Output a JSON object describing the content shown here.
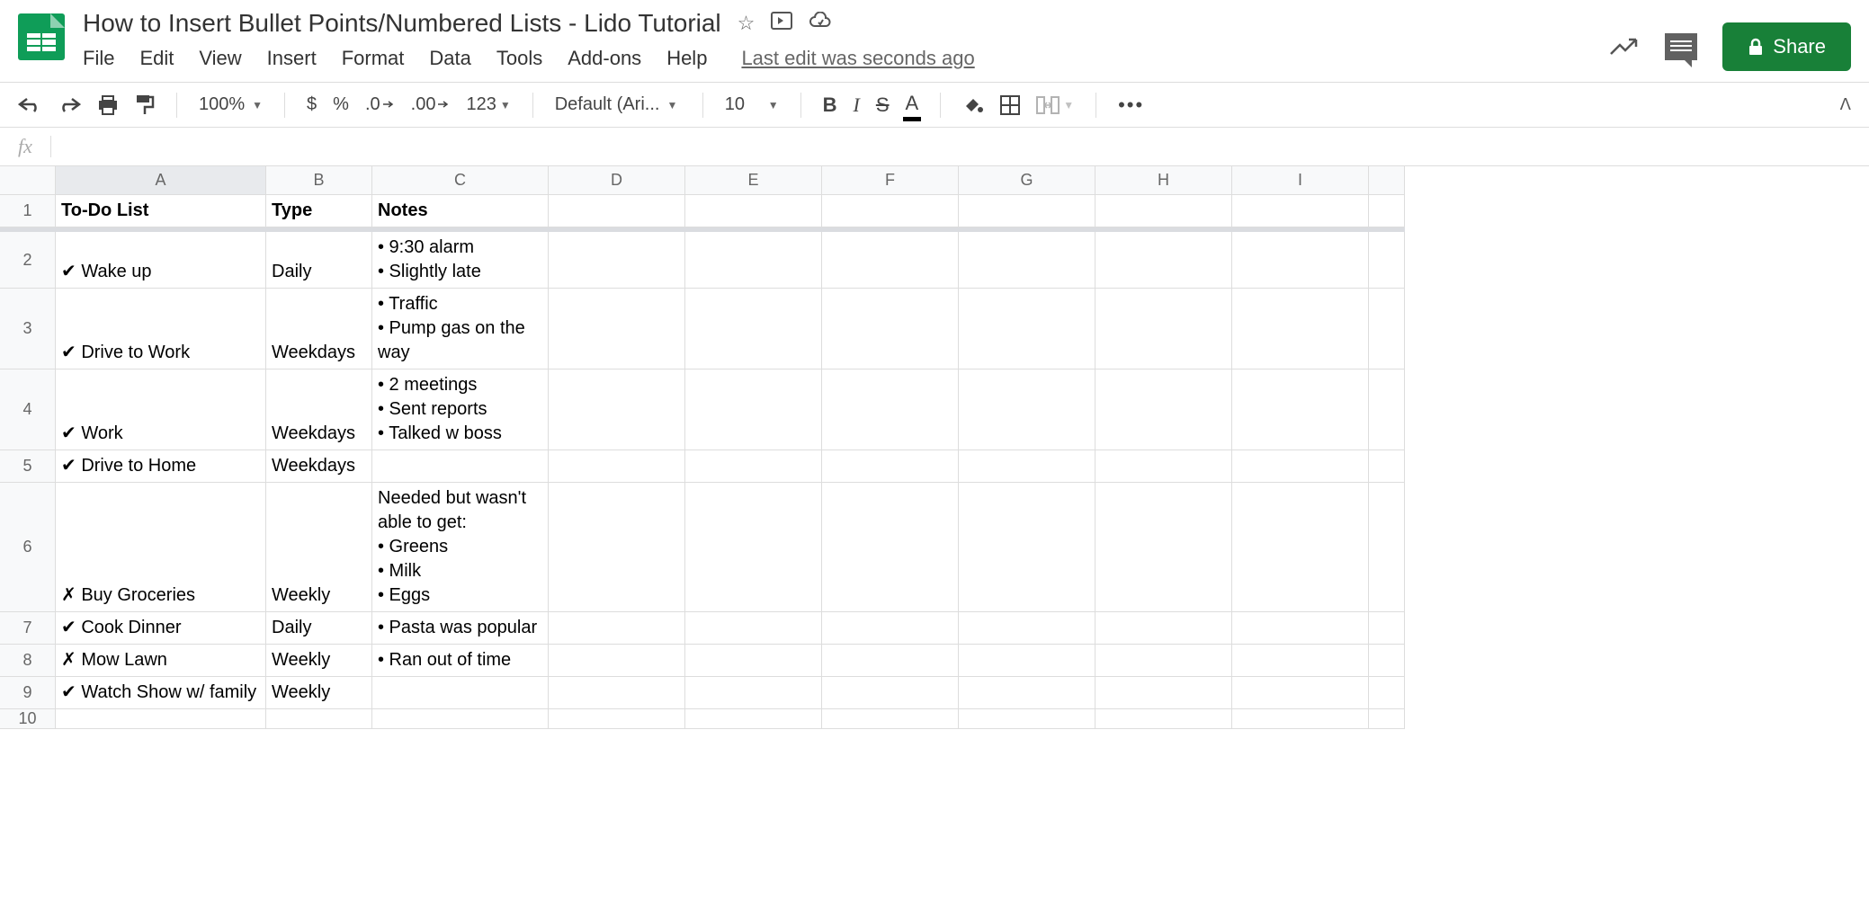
{
  "doc": {
    "title": "How to Insert Bullet Points/Numbered Lists - Lido Tutorial",
    "last_edit": "Last edit was seconds ago"
  },
  "menu": [
    "File",
    "Edit",
    "View",
    "Insert",
    "Format",
    "Data",
    "Tools",
    "Add-ons",
    "Help"
  ],
  "share": {
    "label": "Share"
  },
  "toolbar": {
    "zoom": "100%",
    "currency": "$",
    "percent": "%",
    "dec_dec": ".0",
    "inc_dec": ".00",
    "num_fmt": "123",
    "font": "Default (Ari...",
    "font_size": "10",
    "bold": "B",
    "italic": "I",
    "strike": "S",
    "text_color": "A"
  },
  "formula": {
    "label": "fx",
    "value": ""
  },
  "columns": [
    "A",
    "B",
    "C",
    "D",
    "E",
    "F",
    "G",
    "H",
    "I"
  ],
  "headers": {
    "A": "To-Do List",
    "B": "Type",
    "C": "Notes"
  },
  "rows": [
    {
      "num": "1"
    },
    {
      "num": "2",
      "A": "✔ Wake up",
      "B": "Daily",
      "C": "• 9:30 alarm\n• Slightly late"
    },
    {
      "num": "3",
      "A": "✔ Drive to Work",
      "B": "Weekdays",
      "C": "• Traffic\n• Pump gas on the way"
    },
    {
      "num": "4",
      "A": "✔ Work",
      "B": "Weekdays",
      "C": "• 2 meetings\n• Sent reports\n• Talked w boss"
    },
    {
      "num": "5",
      "A": "✔ Drive to Home",
      "B": "Weekdays",
      "C": ""
    },
    {
      "num": "6",
      "A": "✗ Buy Groceries",
      "B": "Weekly",
      "C": "Needed but wasn't able to get:\n• Greens\n• Milk\n• Eggs"
    },
    {
      "num": "7",
      "A": "✔ Cook Dinner",
      "B": "Daily",
      "C": "• Pasta was popular"
    },
    {
      "num": "8",
      "A": "✗ Mow Lawn",
      "B": "Weekly",
      "C": "• Ran out of time"
    },
    {
      "num": "9",
      "A": "✔ Watch Show w/ family",
      "B": "Weekly",
      "C": ""
    },
    {
      "num": "10",
      "A": "",
      "B": "",
      "C": ""
    }
  ]
}
